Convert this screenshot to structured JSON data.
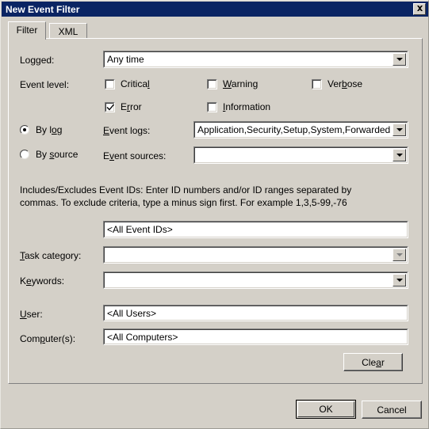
{
  "window": {
    "title": "New Event Filter",
    "close_icon": "close-icon"
  },
  "tabs": [
    {
      "label": "Filter",
      "active": true
    },
    {
      "label": "XML",
      "active": false
    }
  ],
  "form": {
    "logged": {
      "label": "Logged:",
      "value": "Any time",
      "arrow_icon": "chevron-down-icon"
    },
    "event_level": {
      "label": "Event level:",
      "options": [
        {
          "label": "Critical",
          "checked": false,
          "accel": "l"
        },
        {
          "label": "Warning",
          "checked": false,
          "accel": "W"
        },
        {
          "label": "Verbose",
          "checked": false,
          "accel": "b"
        },
        {
          "label": "Error",
          "checked": true,
          "accel": "r"
        },
        {
          "label": "Information",
          "checked": false,
          "accel": "I"
        }
      ]
    },
    "source_mode": {
      "by_log": {
        "label": "By log",
        "selected": true
      },
      "by_source": {
        "label": "By source",
        "selected": false
      }
    },
    "event_logs": {
      "label": "Event logs:",
      "value": "Application,Security,Setup,System,Forwarded E",
      "arrow_icon": "chevron-down-icon"
    },
    "event_sources": {
      "label": "Event sources:",
      "value": "",
      "arrow_icon": "chevron-down-icon"
    },
    "event_ids": {
      "help_text": "Includes/Excludes Event IDs: Enter ID numbers and/or ID ranges separated by commas. To exclude criteria, type a minus sign first. For example 1,3,5-99,-76",
      "value": "<All Event IDs>"
    },
    "task_category": {
      "label": "Task category:",
      "value": "",
      "arrow_icon": "chevron-down-icon",
      "disabled": true
    },
    "keywords": {
      "label": "Keywords:",
      "value": "",
      "arrow_icon": "chevron-down-icon"
    },
    "user": {
      "label": "User:",
      "value": "<All Users>"
    },
    "computers": {
      "label": "Computer(s):",
      "value": "<All Computers>"
    },
    "clear_button": "Clear"
  },
  "footer": {
    "ok_button": "OK",
    "cancel_button": "Cancel"
  },
  "colors": {
    "titlebar": "#0a2463",
    "dialog_bg": "#d4d0c8",
    "field_bg": "#ffffff",
    "text": "#000000",
    "disabled_arrow": "#808080"
  }
}
